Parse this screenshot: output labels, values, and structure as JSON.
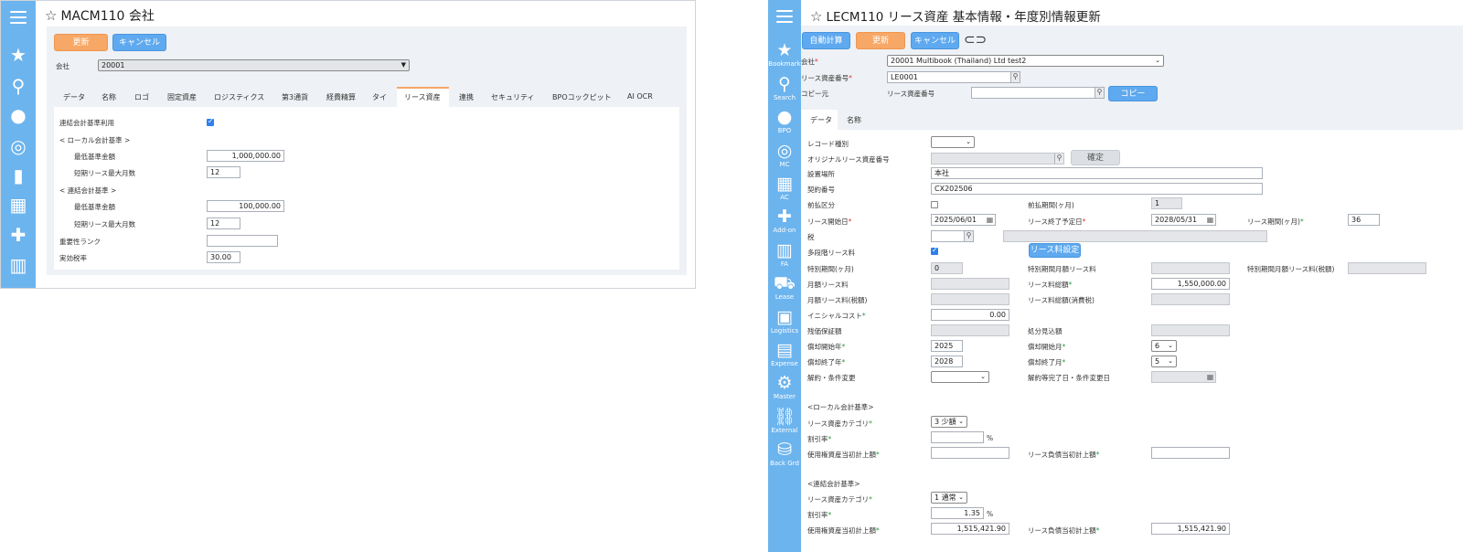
{
  "left": {
    "title": "MACM110 会社",
    "buttons": {
      "update": "更新",
      "cancel": "キャンセル"
    },
    "company_label": "会社",
    "company_value": "20001",
    "tabs": [
      "データ",
      "名称",
      "ロゴ",
      "固定資産",
      "ロジスティクス",
      "第3通貨",
      "経費精算",
      "タイ",
      "リース資産",
      "連携",
      "セキュリティ",
      "BPOコックピット",
      "AI OCR"
    ],
    "active_tab": "リース資産",
    "consolidated_label": "連結会計基準利用",
    "local_header": "< ローカル会計基準 >",
    "local_min_label": "最低基準金額",
    "local_min_value": "1,000,000.00",
    "local_short_label": "短期リース最大月数",
    "local_short_value": "12",
    "consol_header": "< 連結会計基準 >",
    "consol_min_label": "最低基準金額",
    "consol_min_value": "100,000.00",
    "consol_short_label": "短期リース最大月数",
    "consol_short_value": "12",
    "importance_label": "重要性ランク",
    "importance_value": "",
    "tax_label": "実効税率",
    "tax_value": "30.00"
  },
  "right": {
    "title": "LECM110 リース資産 基本情報・年度別情報更新",
    "buttons": {
      "auto_calc": "自動計算",
      "update": "更新",
      "cancel": "キャンセル",
      "copy": "コピー",
      "lease_fee_setting": "リース料設定",
      "confirm": "確定"
    },
    "sidebar": [
      {
        "icon": "star-icon",
        "glyph": "★",
        "label": "Bookmark"
      },
      {
        "icon": "search-icon",
        "glyph": "⚲",
        "label": "Search"
      },
      {
        "icon": "group-icon",
        "glyph": "👥",
        "label": "BPO"
      },
      {
        "icon": "globe-icon",
        "glyph": "◎",
        "label": "MC"
      },
      {
        "icon": "calculator-icon",
        "glyph": "▦",
        "label": "AC"
      },
      {
        "icon": "addon-icon",
        "glyph": "✚",
        "label": "Add-on"
      },
      {
        "icon": "building-icon",
        "glyph": "▥",
        "label": "FA"
      },
      {
        "icon": "truck-icon",
        "glyph": "⛟",
        "label": "Lease"
      },
      {
        "icon": "box-icon",
        "glyph": "▣",
        "label": "Logistics"
      },
      {
        "icon": "briefcase-icon",
        "glyph": "▤",
        "label": "Expense"
      },
      {
        "icon": "gear-icon",
        "glyph": "⚙",
        "label": "Master"
      },
      {
        "icon": "link-icon",
        "glyph": "⛓",
        "label": "External"
      },
      {
        "icon": "database-icon",
        "glyph": "⛁",
        "label": "Back Grd"
      }
    ],
    "company_label": "会社",
    "company_value": "20001 Multibook (Thailand) Ltd test2",
    "asset_no_label": "リース資産番号",
    "asset_no_value": "LE0001",
    "copy_from_label": "コピー元",
    "copy_asset_label": "リース資産番号",
    "tabs": [
      "データ",
      "名称"
    ],
    "record_type_label": "レコード種別",
    "orig_asset_label": "オリジナルリース資産番号",
    "location_label": "設置場所",
    "location_value": "本社",
    "contract_label": "契約番号",
    "contract_value": "CX202506",
    "prepaid_label": "前払区分",
    "prepaid_period_label": "前払期間(ヶ月)",
    "prepaid_period_value": "1",
    "lease_start_label": "リース開始日",
    "lease_start_value": "2025/06/01",
    "lease_end_label": "リース終了予定日",
    "lease_end_value": "2028/05/31",
    "lease_period_label": "リース期間(ヶ月)",
    "lease_period_value": "36",
    "tax_label": "税",
    "multi_stage_label": "多段階リース料",
    "special_period_label": "特別期間(ヶ月)",
    "special_period_value": "0",
    "special_monthly_label": "特別期間月額リース料",
    "special_monthly_tax_label": "特別期間月額リース料(税額)",
    "monthly_label": "月額リース料",
    "total_label": "リース料総額",
    "total_value": "1,550,000.00",
    "monthly_tax_label": "月額リース料(税額)",
    "total_tax_label": "リース料総額(消費税)",
    "initial_cost_label": "イニシャルコスト",
    "initial_cost_value": "0.00",
    "residual_label": "残価保証額",
    "disposal_label": "処分見込額",
    "dep_start_year_label": "償却開始年",
    "dep_start_year_value": "2025",
    "dep_start_month_label": "償却開始月",
    "dep_start_month_value": "6",
    "dep_end_year_label": "償却終了年",
    "dep_end_year_value": "2028",
    "dep_end_month_label": "償却終了月",
    "dep_end_month_value": "5",
    "cancel_change_label": "解約・条件変更",
    "cancel_date_label": "解約等完了日・条件変更日",
    "local_header": "<ローカル会計基準>",
    "local_category_label": "リース資産カテゴリ",
    "local_category_value": "3 少額",
    "local_rate_label": "割引率",
    "local_rate_value": "",
    "local_rou_label": "使用権資産当初計上額",
    "local_liab_label": "リース負債当初計上額",
    "consol_header": "<連結会計基準>",
    "consol_category_label": "リース資産カテゴリ",
    "consol_category_value": "1 通常",
    "consol_rate_label": "割引率",
    "consol_rate_value": "1.35",
    "consol_rou_label": "使用権資産当初計上額",
    "consol_rou_value": "1,515,421.90",
    "consol_liab_label": "リース負債当初計上額",
    "consol_liab_value": "1,515,421.90",
    "percent": "%"
  }
}
